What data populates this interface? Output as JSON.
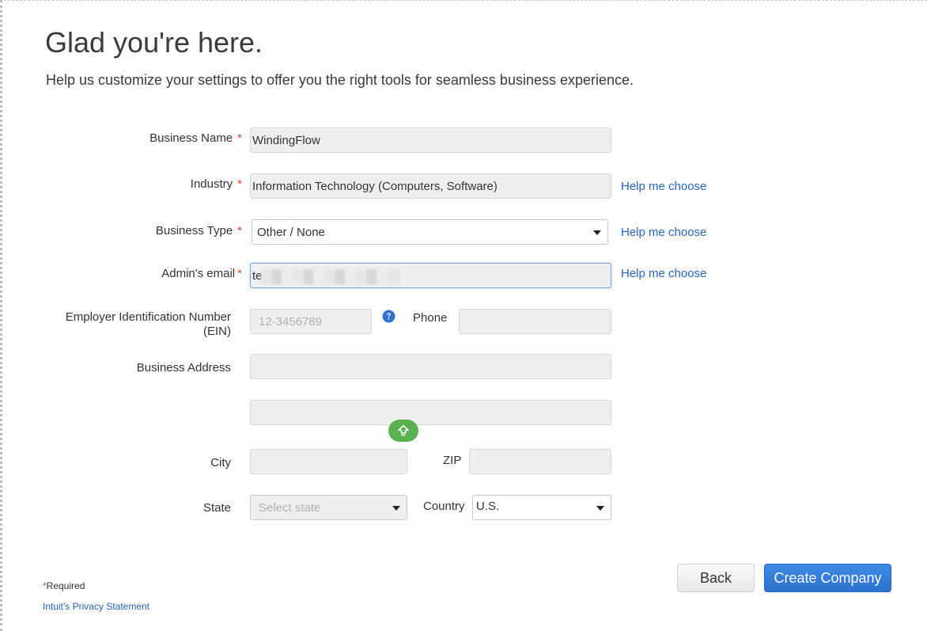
{
  "header": {
    "title": "Glad you're here.",
    "subtitle": "Help us customize your settings to offer you the right tools for seamless business experience."
  },
  "form": {
    "business_name": {
      "label": "Business Name",
      "value": "WindingFlow",
      "required": true
    },
    "industry": {
      "label": "Industry",
      "value": "Information Technology (Computers, Software)",
      "required": true,
      "help_link": "Help me choose"
    },
    "business_type": {
      "label": "Business Type",
      "value": "Other / None",
      "required": true,
      "help_link": "Help me choose"
    },
    "admin_email": {
      "label": "Admin's email",
      "value": "te",
      "required": true,
      "help_link": "Help me choose"
    },
    "ein": {
      "label": "Employer Identification Number (EIN)",
      "placeholder": "12-3456789",
      "value": ""
    },
    "phone": {
      "label": "Phone",
      "value": ""
    },
    "business_address": {
      "label": "Business Address",
      "line1": "",
      "line2": ""
    },
    "city": {
      "label": "City",
      "value": ""
    },
    "zip": {
      "label": "ZIP",
      "value": ""
    },
    "state": {
      "label": "State",
      "placeholder": "Select state"
    },
    "country": {
      "label": "Country",
      "value": "U.S."
    }
  },
  "required_marker": "*",
  "footer": {
    "required_note": "Required",
    "privacy_link": "Intuit's Privacy Statement"
  },
  "buttons": {
    "back": "Back",
    "create": "Create Company"
  },
  "icons": {
    "help": "question-circle-icon",
    "scroll": "arrow-up-icon"
  },
  "colors": {
    "accent": "#2b6fcc",
    "link": "#2a63b4",
    "required": "#e0433e",
    "scroll_button": "#5bb04f"
  }
}
